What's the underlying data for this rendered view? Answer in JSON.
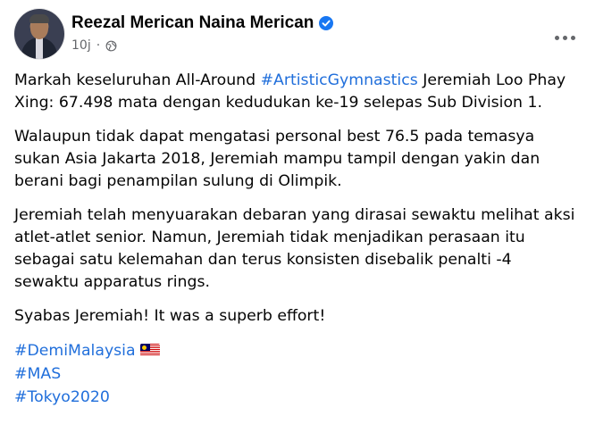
{
  "post": {
    "author": "Reezal Merican Naina Merican",
    "time": "10j",
    "separator": "·",
    "paragraphs": [
      {
        "before": "Markah keseluruhan All-Around ",
        "hashtag": "#ArtisticGymnastics",
        "after": " Jeremiah Loo Phay Xing: 67.498 mata dengan kedudukan ke-19 selepas Sub Division 1."
      },
      {
        "text": "Walaupun tidak dapat mengatasi personal best 76.5 pada temasya sukan Asia Jakarta 2018, Jeremiah mampu tampil dengan yakin dan berani bagi penampilan sulung di Olimpik."
      },
      {
        "text": "Jeremiah telah menyuarakan debaran yang dirasai sewaktu melihat aksi atlet-atlet senior. Namun, Jeremiah tidak menjadikan perasaan itu sebagai satu kelemahan dan terus konsisten disebalik penalti -4 sewaktu apparatus rings."
      },
      {
        "text": "Syabas Jeremiah! It was a superb effort!"
      }
    ],
    "hashtags": [
      "#DemiMalaysia",
      "#MAS",
      "#Tokyo2020"
    ]
  },
  "icons": {
    "verified": "verified-badge-icon",
    "privacy": "globe-icon",
    "more": "more-options-icon",
    "flag": "malaysia-flag-icon"
  },
  "colors": {
    "hashtag": "#216fdb",
    "verified": "#1877f2",
    "meta": "#65676b"
  }
}
